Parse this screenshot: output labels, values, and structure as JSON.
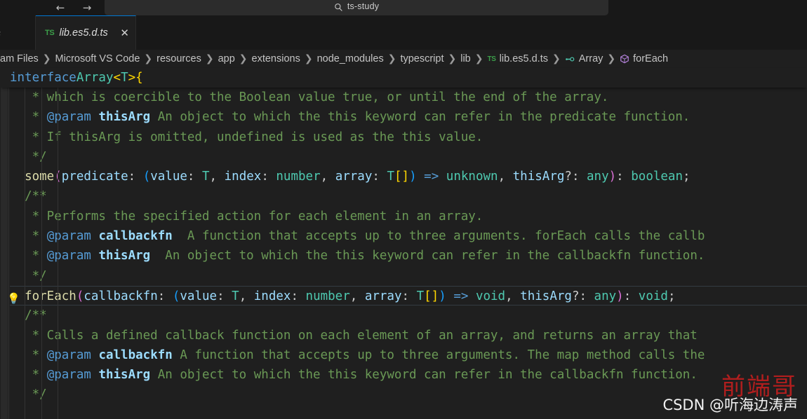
{
  "titlebar": {
    "back_label": "←",
    "forward_label": "→",
    "search_value": "ts-study",
    "search_icon": "search-icon"
  },
  "tabs": {
    "partial_label": "s",
    "active": {
      "icon": "TS",
      "label": "lib.es5.d.ts",
      "close_label": "✕"
    }
  },
  "breadcrumb": {
    "separator": "❯",
    "items": [
      {
        "label": "am Files",
        "icon": ""
      },
      {
        "label": "Microsoft VS Code",
        "icon": ""
      },
      {
        "label": "resources",
        "icon": ""
      },
      {
        "label": "app",
        "icon": ""
      },
      {
        "label": "extensions",
        "icon": ""
      },
      {
        "label": "node_modules",
        "icon": ""
      },
      {
        "label": "typescript",
        "icon": ""
      },
      {
        "label": "lib",
        "icon": ""
      },
      {
        "label": "lib.es5.d.ts",
        "icon": "typescript-file-icon"
      },
      {
        "label": "Array",
        "icon": "interface-symbol-icon"
      },
      {
        "label": "forEach",
        "icon": "method-symbol-icon"
      }
    ]
  },
  "sticky_header": {
    "tokens": [
      {
        "text": "interface",
        "cls": "t-kw"
      },
      {
        "text": " ",
        "cls": "t-white"
      },
      {
        "text": "Array",
        "cls": "t-type"
      },
      {
        "text": "<",
        "cls": "t-br1"
      },
      {
        "text": "T",
        "cls": "t-type"
      },
      {
        "text": ">",
        "cls": "t-br1"
      },
      {
        "text": " ",
        "cls": "t-white"
      },
      {
        "text": "{",
        "cls": "t-br1"
      }
    ]
  },
  "gutter": {
    "lightbulb_icon": "lightbulb-quickfix-icon",
    "lightbulb_glyph": "💡"
  },
  "editor": {
    "current_line_index": 10,
    "lines": [
      {
        "tokens": [
          {
            "text": "   * which is coercible to the Boolean value true, or until the end of the array.",
            "cls": "t-cmt"
          }
        ]
      },
      {
        "tokens": [
          {
            "text": "   * ",
            "cls": "t-cmt"
          },
          {
            "text": "@param",
            "cls": "t-cmtkw"
          },
          {
            "text": " ",
            "cls": "t-cmt"
          },
          {
            "text": "thisArg",
            "cls": "t-cmtprm"
          },
          {
            "text": " An object to which the this keyword can refer in the predicate function.",
            "cls": "t-cmt"
          }
        ]
      },
      {
        "tokens": [
          {
            "text": "   * If thisArg is omitted, undefined is used as the this value.",
            "cls": "t-cmt"
          }
        ]
      },
      {
        "tokens": [
          {
            "text": "   */",
            "cls": "t-cmt"
          }
        ]
      },
      {
        "tokens": [
          {
            "text": "  ",
            "cls": "t-white"
          },
          {
            "text": "some",
            "cls": "t-fn"
          },
          {
            "text": "(",
            "cls": "t-br2"
          },
          {
            "text": "predicate",
            "cls": "t-var"
          },
          {
            "text": ": ",
            "cls": "t-punc"
          },
          {
            "text": "(",
            "cls": "t-br3"
          },
          {
            "text": "value",
            "cls": "t-var"
          },
          {
            "text": ": ",
            "cls": "t-punc"
          },
          {
            "text": "T",
            "cls": "t-type"
          },
          {
            "text": ", ",
            "cls": "t-punc"
          },
          {
            "text": "index",
            "cls": "t-var"
          },
          {
            "text": ": ",
            "cls": "t-punc"
          },
          {
            "text": "number",
            "cls": "t-type"
          },
          {
            "text": ", ",
            "cls": "t-punc"
          },
          {
            "text": "array",
            "cls": "t-var"
          },
          {
            "text": ": ",
            "cls": "t-punc"
          },
          {
            "text": "T",
            "cls": "t-type"
          },
          {
            "text": "[]",
            "cls": "t-br1"
          },
          {
            "text": ")",
            "cls": "t-br3"
          },
          {
            "text": " ",
            "cls": "t-white"
          },
          {
            "text": "=>",
            "cls": "t-arrow"
          },
          {
            "text": " ",
            "cls": "t-white"
          },
          {
            "text": "unknown",
            "cls": "t-type"
          },
          {
            "text": ", ",
            "cls": "t-punc"
          },
          {
            "text": "thisArg",
            "cls": "t-var"
          },
          {
            "text": "?: ",
            "cls": "t-punc"
          },
          {
            "text": "any",
            "cls": "t-type"
          },
          {
            "text": ")",
            "cls": "t-br2"
          },
          {
            "text": ": ",
            "cls": "t-punc"
          },
          {
            "text": "boolean",
            "cls": "t-type"
          },
          {
            "text": ";",
            "cls": "t-punc"
          }
        ]
      },
      {
        "tokens": [
          {
            "text": "  /**",
            "cls": "t-cmt"
          }
        ]
      },
      {
        "tokens": [
          {
            "text": "   * Performs the specified action for each element in an array.",
            "cls": "t-cmt"
          }
        ]
      },
      {
        "tokens": [
          {
            "text": "   * ",
            "cls": "t-cmt"
          },
          {
            "text": "@param",
            "cls": "t-cmtkw"
          },
          {
            "text": " ",
            "cls": "t-cmt"
          },
          {
            "text": "callbackfn",
            "cls": "t-cmtprm"
          },
          {
            "text": "  A function that accepts up to three arguments. forEach calls the callb",
            "cls": "t-cmt"
          }
        ]
      },
      {
        "tokens": [
          {
            "text": "   * ",
            "cls": "t-cmt"
          },
          {
            "text": "@param",
            "cls": "t-cmtkw"
          },
          {
            "text": " ",
            "cls": "t-cmt"
          },
          {
            "text": "thisArg",
            "cls": "t-cmtprm"
          },
          {
            "text": "  An object to which the this keyword can refer in the callbackfn function.",
            "cls": "t-cmt"
          }
        ]
      },
      {
        "tokens": [
          {
            "text": "   */",
            "cls": "t-cmt"
          }
        ]
      },
      {
        "tokens": [
          {
            "text": "  ",
            "cls": "t-white"
          },
          {
            "text": "forEach",
            "cls": "t-fn"
          },
          {
            "text": "(",
            "cls": "t-br2"
          },
          {
            "text": "callbackfn",
            "cls": "t-var"
          },
          {
            "text": ": ",
            "cls": "t-punc"
          },
          {
            "text": "(",
            "cls": "t-br3"
          },
          {
            "text": "value",
            "cls": "t-var"
          },
          {
            "text": ": ",
            "cls": "t-punc"
          },
          {
            "text": "T",
            "cls": "t-type"
          },
          {
            "text": ", ",
            "cls": "t-punc"
          },
          {
            "text": "index",
            "cls": "t-var"
          },
          {
            "text": ": ",
            "cls": "t-punc"
          },
          {
            "text": "number",
            "cls": "t-type"
          },
          {
            "text": ", ",
            "cls": "t-punc"
          },
          {
            "text": "array",
            "cls": "t-var"
          },
          {
            "text": ": ",
            "cls": "t-punc"
          },
          {
            "text": "T",
            "cls": "t-type"
          },
          {
            "text": "[]",
            "cls": "t-br1"
          },
          {
            "text": ")",
            "cls": "t-br3"
          },
          {
            "text": " ",
            "cls": "t-white"
          },
          {
            "text": "=>",
            "cls": "t-arrow"
          },
          {
            "text": " ",
            "cls": "t-white"
          },
          {
            "text": "void",
            "cls": "t-type"
          },
          {
            "text": ", ",
            "cls": "t-punc"
          },
          {
            "text": "thisArg",
            "cls": "t-var"
          },
          {
            "text": "?: ",
            "cls": "t-punc"
          },
          {
            "text": "any",
            "cls": "t-type"
          },
          {
            "text": ")",
            "cls": "t-br2"
          },
          {
            "text": ": ",
            "cls": "t-punc"
          },
          {
            "text": "void",
            "cls": "t-type"
          },
          {
            "text": ";",
            "cls": "t-punc"
          }
        ]
      },
      {
        "tokens": [
          {
            "text": "  /**",
            "cls": "t-cmt"
          }
        ]
      },
      {
        "tokens": [
          {
            "text": "   * Calls a defined callback function on each element of an array, and returns an array that",
            "cls": "t-cmt"
          }
        ]
      },
      {
        "tokens": [
          {
            "text": "   * ",
            "cls": "t-cmt"
          },
          {
            "text": "@param",
            "cls": "t-cmtkw"
          },
          {
            "text": " ",
            "cls": "t-cmt"
          },
          {
            "text": "callbackfn",
            "cls": "t-cmtprm"
          },
          {
            "text": " A function that accepts up to three arguments. The map method calls the",
            "cls": "t-cmt"
          }
        ]
      },
      {
        "tokens": [
          {
            "text": "   * ",
            "cls": "t-cmt"
          },
          {
            "text": "@param",
            "cls": "t-cmtkw"
          },
          {
            "text": " ",
            "cls": "t-cmt"
          },
          {
            "text": "thisArg",
            "cls": "t-cmtprm"
          },
          {
            "text": " An object to which the this keyword can refer in the callbackfn function.",
            "cls": "t-cmt"
          }
        ]
      },
      {
        "tokens": [
          {
            "text": "   */",
            "cls": "t-cmt"
          }
        ]
      }
    ]
  },
  "watermark": {
    "red_text": "前端哥",
    "csdn_text": "CSDN @听海边涛声"
  },
  "colors": {
    "editor_background": "#1f1f1f",
    "chrome_background": "#181818",
    "tab_active_border": "#0078d4",
    "comment": "#6a9955",
    "keyword": "#569cd6",
    "type": "#4ec9b0",
    "function": "#dcdcaa",
    "variable": "#9cdcfe",
    "bracket_yellow": "#ffd700",
    "bracket_magenta": "#da70d6",
    "bracket_blue": "#179fff",
    "watermark_red": "#d61e1e"
  }
}
